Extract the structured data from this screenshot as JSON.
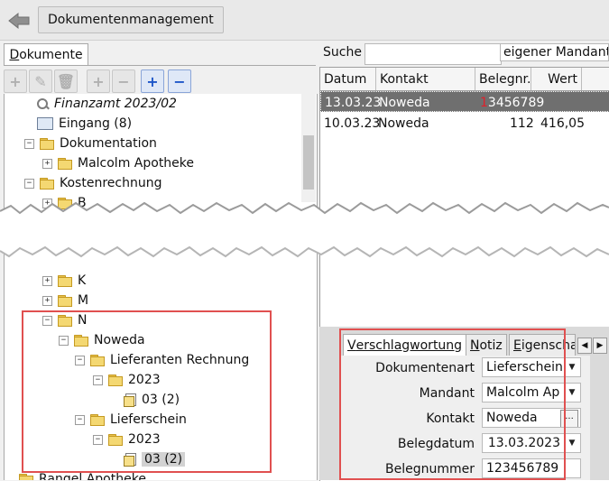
{
  "app": {
    "title_button": "Dokumentenmanagement"
  },
  "left": {
    "tab_label_first": "D",
    "tab_label_rest": "okumente",
    "tree_top": [
      {
        "label": "Finanzamt 2023/02"
      },
      {
        "label": "Eingang (8)"
      },
      {
        "label": "Dokumentation"
      },
      {
        "label": "Malcolm Apotheke"
      },
      {
        "label": "Kostenrechnung"
      },
      {
        "label": "B"
      }
    ],
    "tree_bottom": [
      {
        "label": "K"
      },
      {
        "label": "M"
      },
      {
        "label": "N"
      },
      {
        "label": "Noweda"
      },
      {
        "label": "Lieferanten Rechnung"
      },
      {
        "label": "2023"
      },
      {
        "label": "03 (2)"
      },
      {
        "label": "Lieferschein"
      },
      {
        "label": "2023"
      },
      {
        "label": "03 (2)"
      },
      {
        "label": "Rangel Apotheke"
      }
    ]
  },
  "right": {
    "search_label": "Suche",
    "search_value": "",
    "mandant_select": "eigener Mandant",
    "columns": [
      "Datum",
      "Kontakt",
      "Belegnr.",
      "Wert"
    ],
    "rows": [
      {
        "datum": "13.03.23",
        "kontakt": "Noweda",
        "belegnr_mark": "1",
        "belegnr": "3456789",
        "wert": ""
      },
      {
        "datum": "10.03.23",
        "kontakt": "Noweda",
        "belegnr_mark": "",
        "belegnr": "112",
        "wert": "416,05"
      }
    ],
    "detail_tabs": [
      {
        "label_first": "V",
        "label_rest": "erschlagwortung"
      },
      {
        "label_first": "N",
        "label_rest": "otiz"
      },
      {
        "label_first": "E",
        "label_rest": "igenscha"
      }
    ],
    "form": {
      "dokumentenart_label": "Dokumentenart",
      "dokumentenart_value": "Lieferschein",
      "mandant_label": "Mandant",
      "mandant_value": "Malcolm Ap",
      "kontakt_label": "Kontakt",
      "kontakt_value": "Noweda",
      "kontakt_btn": "···",
      "belegdatum_label": "Belegdatum",
      "belegdatum_value": "13.03.2023",
      "belegnummer_label": "Belegnummer",
      "belegnummer_value": "123456789"
    }
  },
  "colors": {
    "highlight": "#e05050",
    "selection_row": "#6f6f6f",
    "folder": "#f4d872"
  }
}
